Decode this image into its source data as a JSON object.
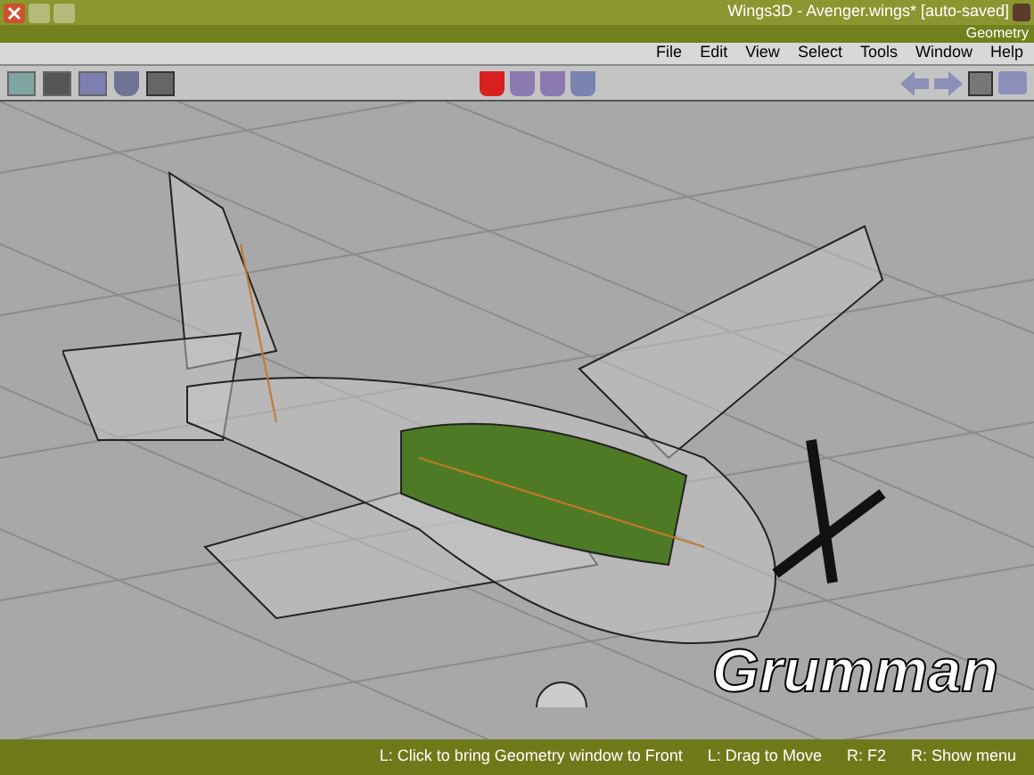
{
  "window": {
    "title": "Wings3D - Avenger.wings* [auto-saved]"
  },
  "geometry_bar": {
    "title": "Geometry"
  },
  "menu": [
    "File",
    "Edit",
    "View",
    "Select",
    "Tools",
    "Window",
    "Help"
  ],
  "viewport": {
    "logo": "Grumman"
  },
  "status_bar": [
    "L: Click to bring Geometry window to Front",
    "L: Drag to Move",
    "R: F2",
    "R: Show menu"
  ]
}
